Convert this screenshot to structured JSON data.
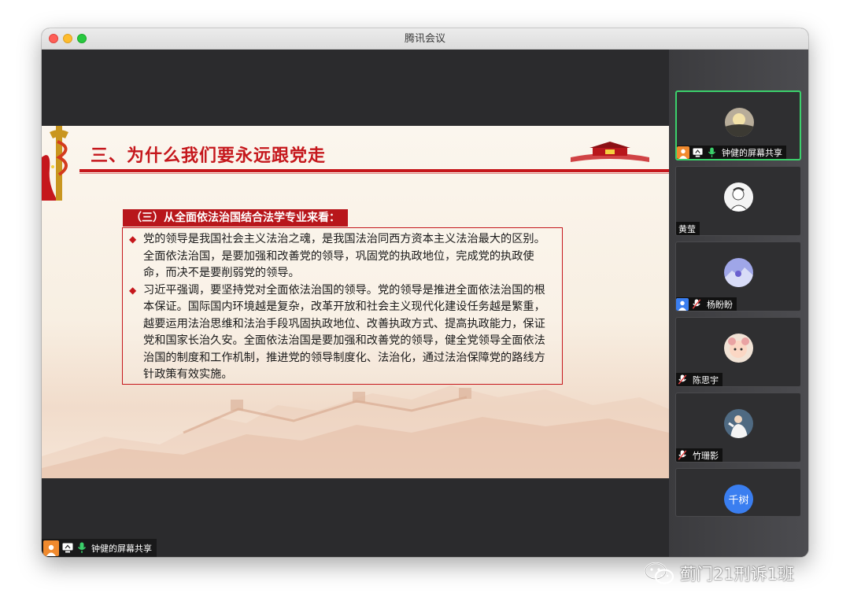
{
  "window": {
    "title": "腾讯会议"
  },
  "slide": {
    "title": "三、为什么我们要永远跟党走",
    "subheading": "（三）从全面依法治国结合法学专业来看：",
    "bullets": [
      "党的领导是我国社会主义法治之魂，是我国法治同西方资本主义法治最大的区别。全面依法治国，是要加强和改善党的领导，巩固党的执政地位，完成党的执政使命，而决不是要削弱党的领导。",
      "习近平强调，要坚持党对全面依法治国的领导。党的领导是推进全面依法治国的根本保证。国际国内环境越是复杂，改革开放和社会主义现代化建设任务越是繁重，越要运用法治思维和法治手段巩固执政地位、改善执政方式、提高执政能力，保证党和国家长治久安。全面依法治国是要加强和改善党的领导，健全党领导全面依法治国的制度和工作机制，推进党的领导制度化、法治化，通过法治保障党的路线方针政策有效实施。"
    ]
  },
  "share_badge": {
    "label": "钟健的屏幕共享"
  },
  "participants": [
    {
      "name": "钟健的屏幕共享",
      "active": true
    },
    {
      "name": "黄莹"
    },
    {
      "name": "杨盼盼"
    },
    {
      "name": "陈思宇"
    },
    {
      "name": "竹珊影"
    },
    {
      "name": "",
      "avatar_text": "千树"
    }
  ],
  "watermark": {
    "text": "蓟门21刑诉1班"
  },
  "colors": {
    "accent_red": "#c5171c",
    "speaker_green": "#3bd06b",
    "avatar_blue": "#3a7ef0",
    "avatar_orange": "#f08a2e"
  }
}
